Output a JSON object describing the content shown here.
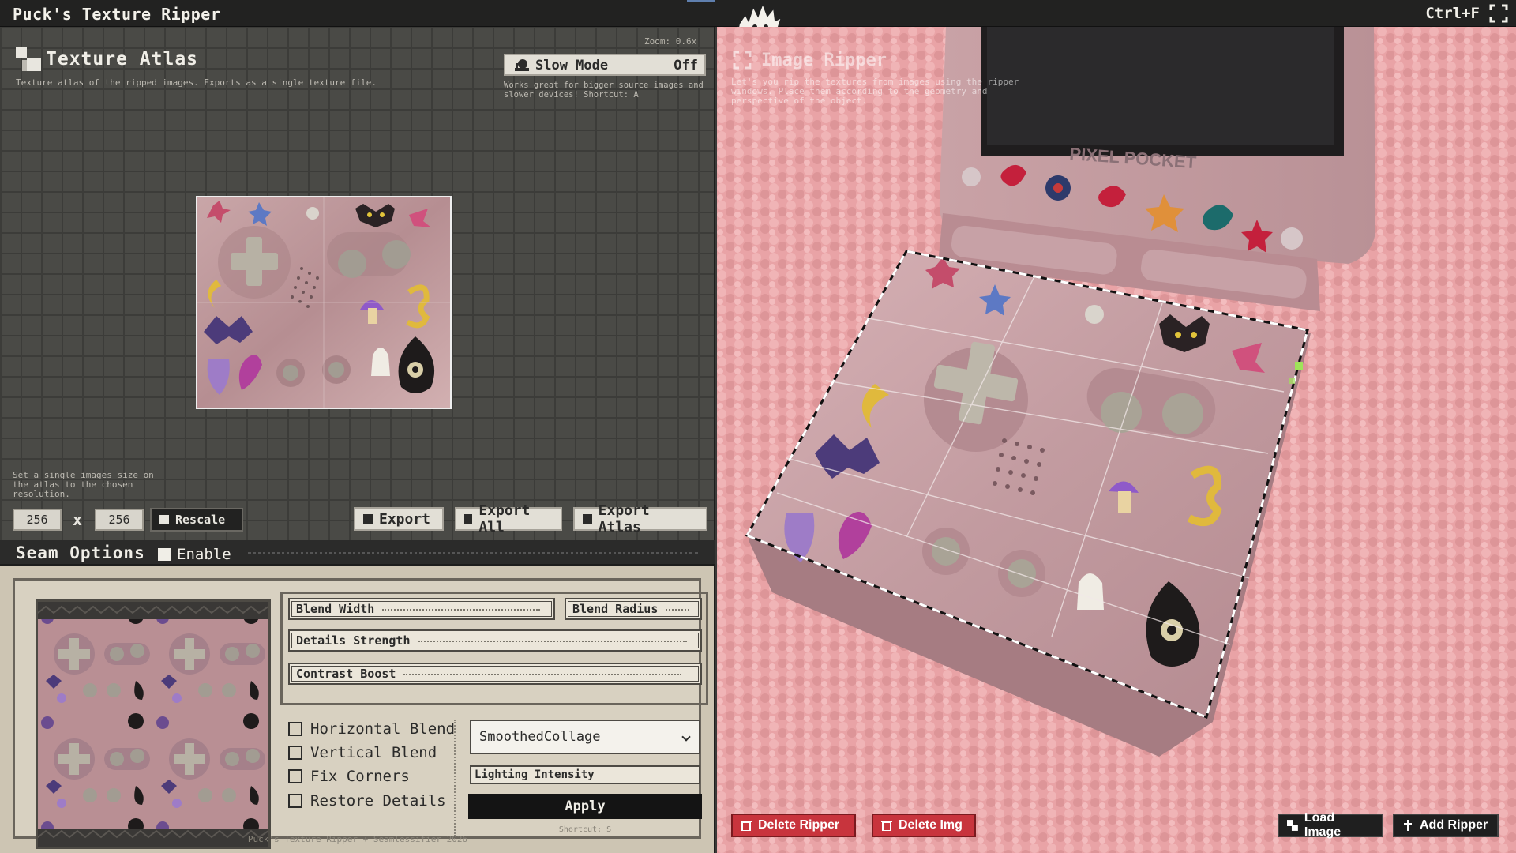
{
  "window": {
    "title": "Puck's Texture Ripper",
    "shortcut": "Ctrl+F"
  },
  "atlas": {
    "title": "Texture Atlas",
    "description": "Texture atlas of the ripped images. Exports as a single texture file.",
    "zoom": "Zoom:  0.6x",
    "slow_mode": {
      "label": "Slow Mode",
      "value": "Off",
      "description": "Works great for bigger source images and slower devices! Shortcut: A"
    },
    "rescale": {
      "description": "Set a single images size on the atlas to the chosen resolution.",
      "width": "256",
      "height": "256",
      "times": "x",
      "button": "Rescale"
    },
    "buttons": {
      "export": "Export",
      "export_all": "Export All",
      "export_atlas": "Export Atlas"
    }
  },
  "seam": {
    "title": "Seam Options",
    "enable_label": "Enable",
    "sliders": {
      "blend_width": "Blend Width",
      "blend_radius": "Blend Radius",
      "details_strength": "Details Strength",
      "contrast_boost": "Contrast Boost"
    },
    "options": [
      "Horizontal Blend",
      "Vertical Blend",
      "Fix Corners",
      "Restore Details"
    ],
    "mode": "SmoothedCollage",
    "lighting": "Lighting Intensity",
    "apply": "Apply",
    "apply_shortcut": "Shortcut: S",
    "footer": "Puck's Texture Ripper + Seamlessifier 2026"
  },
  "ripper": {
    "title": "Image Ripper",
    "description": "Let's you rip the textures from images using the ripper windows. Place them according to the geometry and perspective of the object.",
    "buttons": {
      "delete_ripper": "Delete Ripper",
      "delete_img": "Delete Img",
      "load_image": "Load Image",
      "add_ripper": "Add Ripper"
    }
  },
  "colors": {
    "accent_red": "#c8343d",
    "panel_beige": "#cdc5b3",
    "grid_bg": "#4a4a46"
  }
}
